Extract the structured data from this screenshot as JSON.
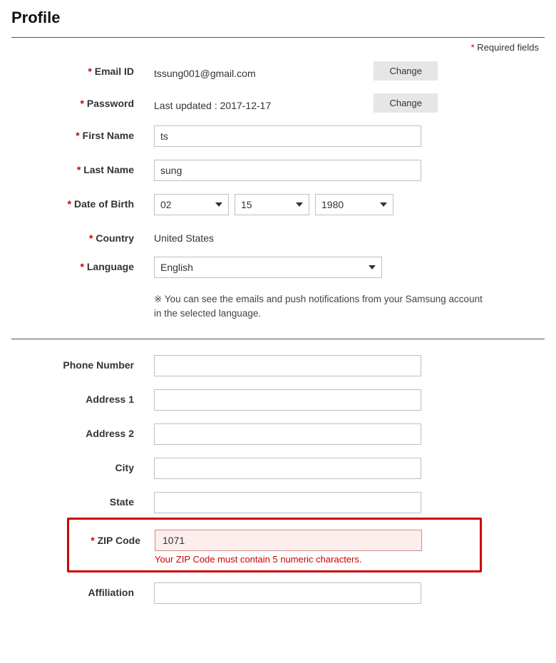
{
  "page_title": "Profile",
  "required_note": "Required fields",
  "labels": {
    "email": "Email ID",
    "password": "Password",
    "first_name": "First Name",
    "last_name": "Last Name",
    "dob": "Date of Birth",
    "country": "Country",
    "language": "Language",
    "phone": "Phone Number",
    "address1": "Address 1",
    "address2": "Address 2",
    "city": "City",
    "state": "State",
    "zip": "ZIP Code",
    "affiliation": "Affiliation"
  },
  "values": {
    "email": "tssung001@gmail.com",
    "password_info": "Last updated : 2017-12-17",
    "first_name": "ts",
    "last_name": "sung",
    "dob_month": "02",
    "dob_day": "15",
    "dob_year": "1980",
    "country": "United States",
    "language": "English",
    "phone": "",
    "address1": "",
    "address2": "",
    "city": "",
    "state": "",
    "zip": "1071",
    "affiliation": ""
  },
  "buttons": {
    "change": "Change"
  },
  "helper": {
    "language": "※ You can see the emails and push notifications from your Samsung account in the selected language."
  },
  "errors": {
    "zip": "Your ZIP Code must contain 5 numeric characters."
  }
}
